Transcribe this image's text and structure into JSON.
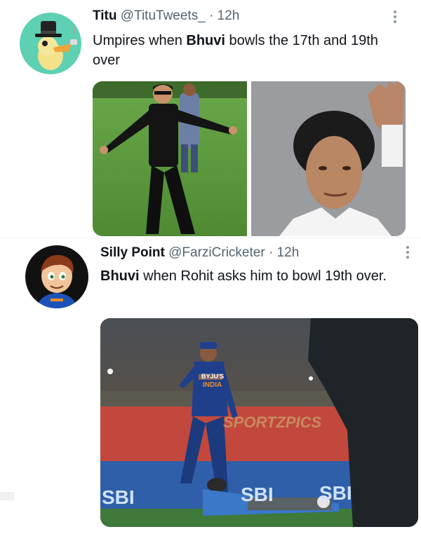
{
  "tweets": [
    {
      "name": "Titu",
      "handle": "@TituTweets_",
      "time": "· 12h",
      "text_before": "Umpires when ",
      "text_bold": "Bhuvi",
      "text_after": " bowls the 17th and 19th over",
      "avatar_icon": "duck-with-hat-avatar",
      "images": [
        "man-in-black-arms-spread-on-field",
        "man-waving-closeup"
      ]
    },
    {
      "name": "Silly Point",
      "handle": "@FarziCricketer",
      "time": "· 12h",
      "text_bold": "Bhuvi",
      "text_after": " when Rohit asks him to bowl 19th over.",
      "avatar_icon": "cartoon-boy-india-jersey-avatar",
      "image": "cricketer-lying-on-ground-stadium",
      "image_texts": {
        "jersey_brand": "BYJU'S",
        "jersey_team": "INDIA",
        "watermark": "SPORTZPICS",
        "board_left": "SBI",
        "board_mid": "SBI",
        "board_right": "SBI"
      }
    }
  ],
  "colors": {
    "text": "#0f1419",
    "secondary": "#536471",
    "field_green": "#5f9e3c",
    "india_blue": "#1f3f8a"
  }
}
